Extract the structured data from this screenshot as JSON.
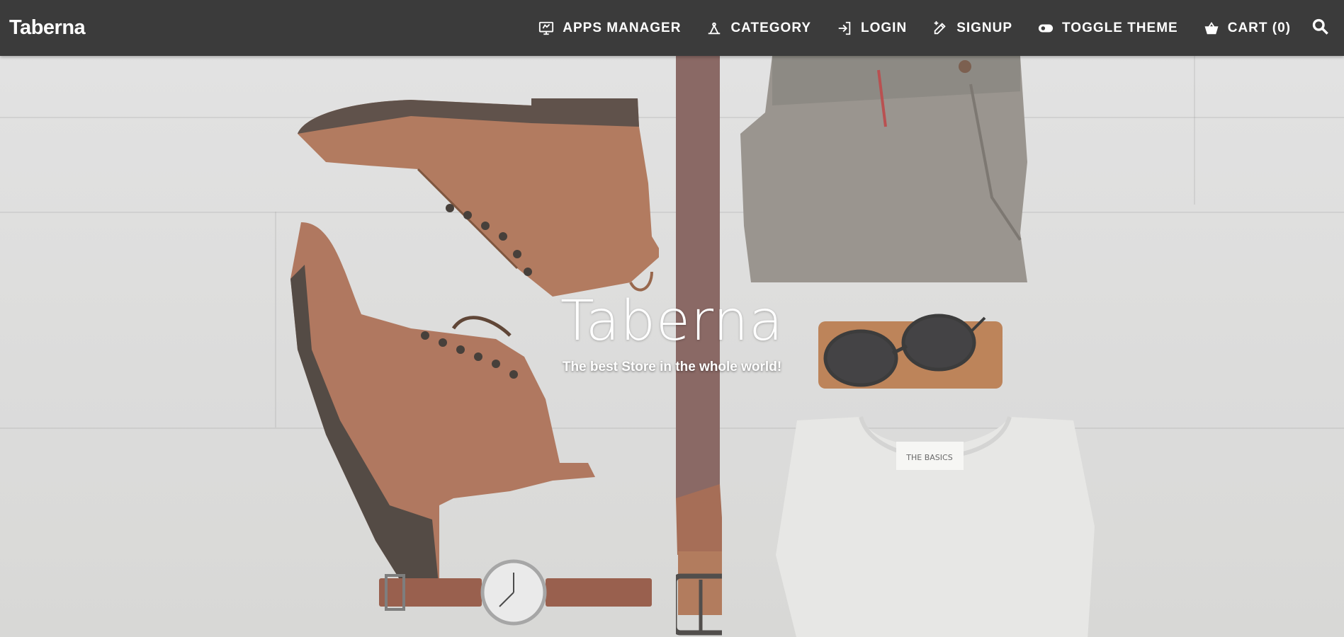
{
  "header": {
    "brand": "Taberna",
    "nav": [
      {
        "label": "APPS MANAGER",
        "icon": "apps-monitor-icon"
      },
      {
        "label": "CATEGORY",
        "icon": "category-icon"
      },
      {
        "label": "LOGIN",
        "icon": "login-icon"
      },
      {
        "label": "SIGNUP",
        "icon": "signup-pencil-icon"
      },
      {
        "label": "TOGGLE THEME",
        "icon": "toggle-icon"
      },
      {
        "label": "CART (0)",
        "icon": "cart-basket-icon"
      }
    ],
    "search_icon": "search-icon"
  },
  "hero": {
    "title": "Taberna",
    "subtitle": "The best Store in the whole world!",
    "shirt_tag": "THE BASICS"
  },
  "colors": {
    "topbar": "#3b3b3b",
    "text": "#ffffff",
    "background": "#d9d9d7",
    "leather": "#9a6040"
  }
}
